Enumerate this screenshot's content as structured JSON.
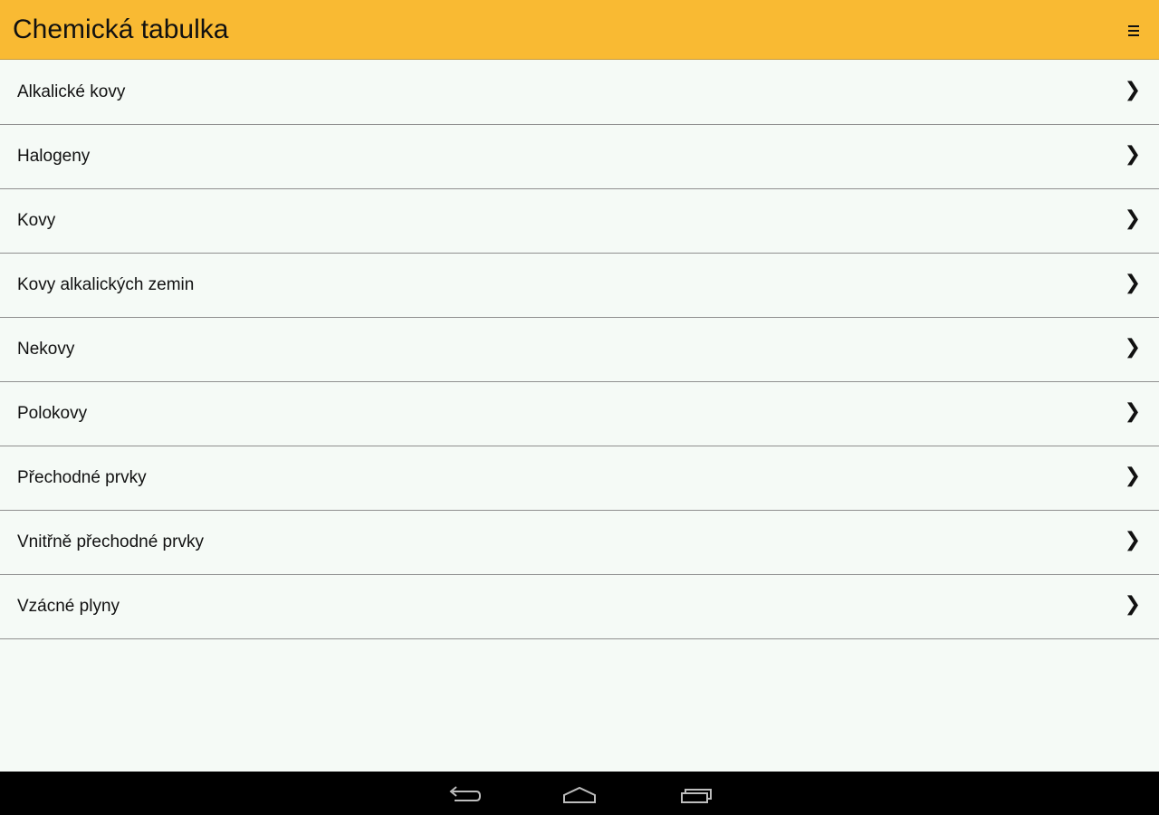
{
  "header": {
    "title": "Chemická tabulka",
    "menu_icon": "hamburger-icon"
  },
  "list": {
    "items": [
      {
        "label": "Alkalické kovy",
        "icon": "chevron-right-icon"
      },
      {
        "label": "Halogeny",
        "icon": "chevron-right-icon"
      },
      {
        "label": "Kovy",
        "icon": "chevron-right-icon"
      },
      {
        "label": "Kovy alkalických zemin",
        "icon": "chevron-right-icon"
      },
      {
        "label": "Nekovy",
        "icon": "chevron-right-icon"
      },
      {
        "label": "Polokovy",
        "icon": "chevron-right-icon"
      },
      {
        "label": "Přechodné prvky",
        "icon": "chevron-right-icon"
      },
      {
        "label": "Vnitřně přechodné prvky",
        "icon": "chevron-right-icon"
      },
      {
        "label": "Vzácné plyny",
        "icon": "chevron-right-icon"
      }
    ]
  },
  "chevron_glyph": "❯",
  "navbar": {
    "buttons": [
      "back-icon",
      "home-icon",
      "recent-apps-icon"
    ]
  },
  "colors": {
    "header_bg": "#f9ba33",
    "page_bg": "#f5faf6",
    "divider": "#8f8f8f",
    "navbar_bg": "#000000"
  }
}
